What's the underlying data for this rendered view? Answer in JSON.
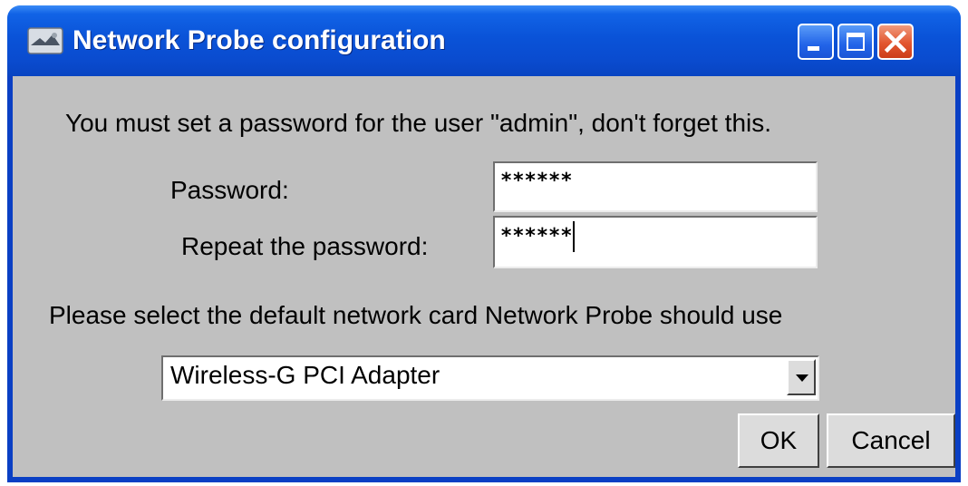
{
  "window": {
    "title": "Network Probe configuration",
    "icon": "network-probe-app-icon",
    "controls": [
      "minimize-icon",
      "maximize-icon",
      "close-icon"
    ]
  },
  "form": {
    "intro_text": "You must set a password for the user \"admin\", don't forget this.",
    "password_label": "Password:",
    "password_value": "******",
    "repeat_label": "Repeat the password:",
    "repeat_value": "******",
    "network_prompt": "Please select the default network card Network Probe should use",
    "network_card_selected": "Wireless-G PCI Adapter"
  },
  "buttons": {
    "ok_label": "OK",
    "cancel_label": "Cancel"
  },
  "colors": {
    "titlebar": "#0a53d8",
    "close_button": "#e2562f",
    "client_background": "#c0c0c0"
  }
}
